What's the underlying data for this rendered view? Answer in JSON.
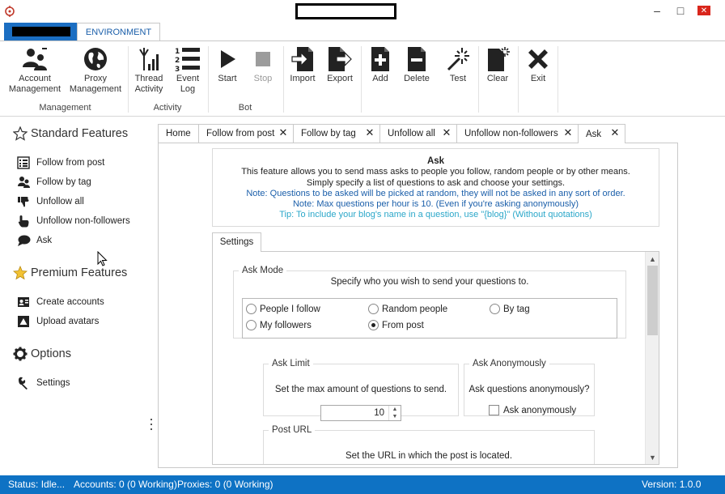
{
  "ribbon": {
    "tab_environment": "ENVIRONMENT",
    "buttons": {
      "account_management": [
        "Account",
        "Management"
      ],
      "proxy_management": [
        "Proxy",
        "Management"
      ],
      "thread_activity": [
        "Thread",
        "Activity"
      ],
      "event_log": [
        "Event",
        "Log"
      ],
      "start": "Start",
      "stop": "Stop",
      "import": "Import",
      "export": "Export",
      "add": "Add",
      "delete": "Delete",
      "test": "Test",
      "clear": "Clear",
      "exit": "Exit"
    },
    "groups": {
      "management": "Management",
      "activity": "Activity",
      "bot": "Bot"
    }
  },
  "sidebar": {
    "standard_title": "Standard Features",
    "standard_items": [
      "Follow from post",
      "Follow by tag",
      "Unfollow all",
      "Unfollow non-followers",
      "Ask"
    ],
    "premium_title": "Premium Features",
    "premium_items": [
      "Create accounts",
      "Upload avatars"
    ],
    "options_title": "Options",
    "options_items": [
      "Settings"
    ]
  },
  "tabs": [
    "Home",
    "Follow from post",
    "Follow by tag",
    "Unfollow all",
    "Unfollow non-followers",
    "Ask"
  ],
  "info": {
    "heading": "Ask",
    "line1": "This feature allows you to send mass asks to people you follow, random people or by other means.",
    "line2": "Simply specify a list of questions to ask and choose your settings.",
    "note1": "Note: Questions to be asked will be picked at random, they will not be asked in any sort of order.",
    "note2": "Note: Max questions per hour is 10. (Even if you're asking anonymously)",
    "tip": "Tip: To include your blog's name in a question, use \"{blog}\" (Without quotations)"
  },
  "settings": {
    "tab_label": "Settings",
    "ask_mode": {
      "legend": "Ask Mode",
      "description": "Specify who you wish to send your questions to.",
      "options": [
        "People I follow",
        "Random people",
        "By tag",
        "My followers",
        "From post"
      ],
      "selected": "From post"
    },
    "ask_limit": {
      "legend": "Ask Limit",
      "description": "Set the max amount of questions to send.",
      "value": "10"
    },
    "ask_anonymously": {
      "legend": "Ask Anonymously",
      "description": "Ask questions anonymously?",
      "checkbox_label": "Ask anonymously",
      "checked": false
    },
    "post_url": {
      "legend": "Post URL",
      "description": "Set the URL in which the post is located.",
      "value": ""
    }
  },
  "status": {
    "state": "Status: Idle...",
    "accounts": "Accounts: 0 (0 Working)",
    "proxies": "Proxies: 0 (0 Working)",
    "version": "Version: 1.0.0"
  },
  "colors": {
    "accent": "#1b6ec2",
    "statusbar": "#0e72c4",
    "note": "#1b5faa",
    "tip": "#2ba7c9"
  }
}
